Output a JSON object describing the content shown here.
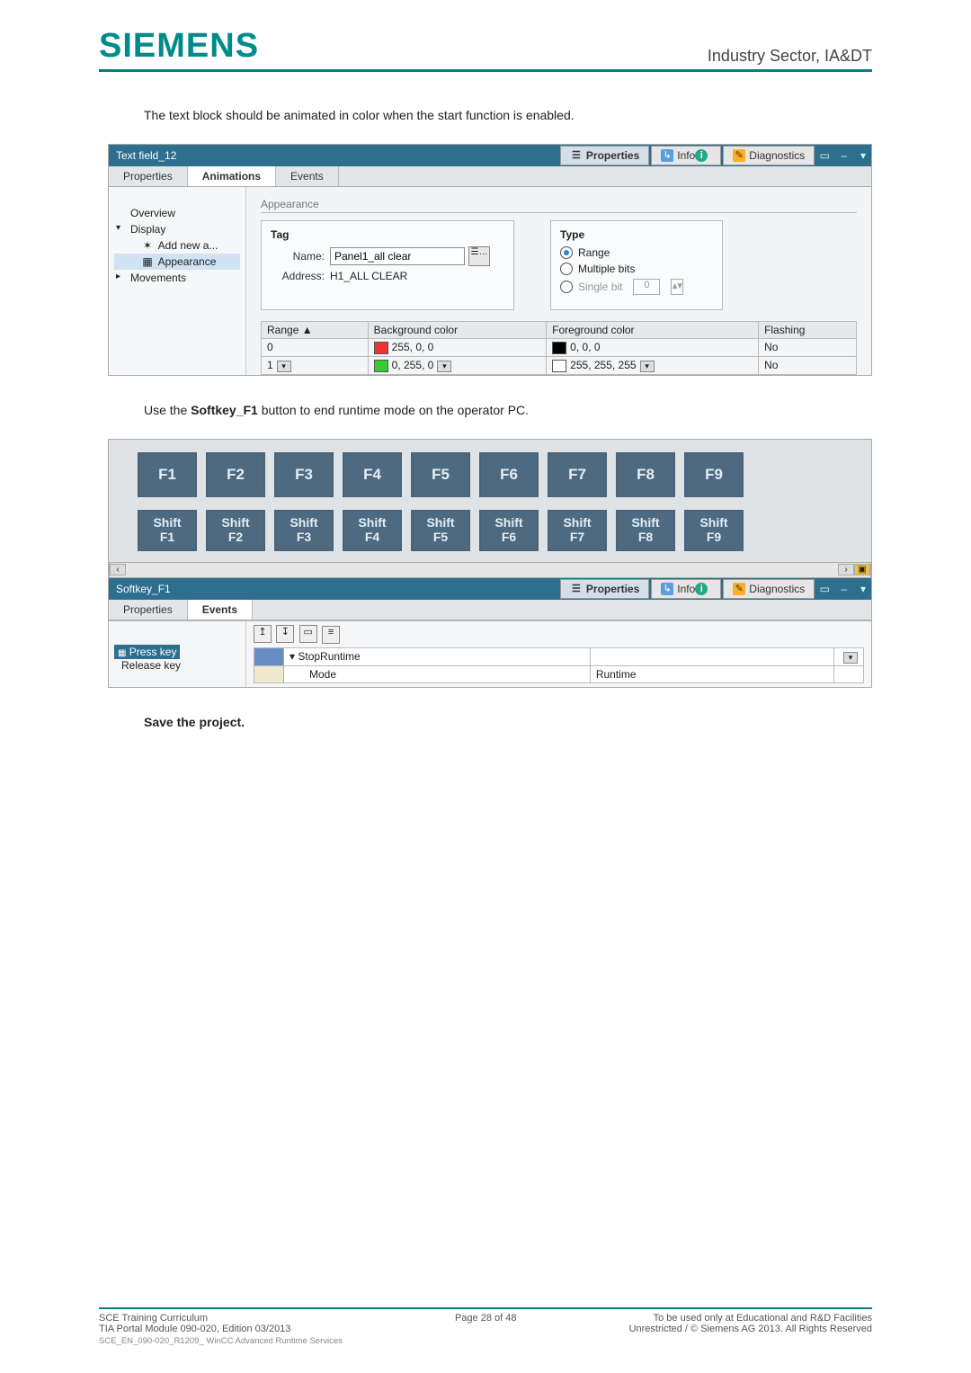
{
  "header": {
    "brand": "SIEMENS",
    "sector": "Industry Sector, IA&DT"
  },
  "intro_text": "The text block should be animated in color when the start function is enabled.",
  "panel1": {
    "title": "Text field_12",
    "tabs_top": {
      "properties": "Properties",
      "info": "Info",
      "diagnostics": "Diagnostics"
    },
    "subtabs": {
      "properties": "Properties",
      "animations": "Animations",
      "events": "Events"
    },
    "tree": {
      "overview": "Overview",
      "display": "Display",
      "add_new": "Add new a...",
      "appearance": "Appearance",
      "movements": "Movements"
    },
    "section_heading": "Appearance",
    "tag_box": {
      "title": "Tag",
      "name_label": "Name:",
      "name_value": "Panel1_all clear",
      "addr_label": "Address:",
      "addr_value": "H1_ALL CLEAR"
    },
    "type_box": {
      "title": "Type",
      "range": "Range",
      "multiple": "Multiple bits",
      "single": "Single bit",
      "single_val": "0"
    },
    "table": {
      "headers": {
        "range": "Range ▲",
        "bg": "Background color",
        "fg": "Foreground color",
        "flash": "Flashing"
      },
      "rows": [
        {
          "range": "0",
          "bg": "255, 0, 0",
          "fg": "0, 0, 0",
          "flash": "No"
        },
        {
          "range": "1",
          "bg": "0, 255, 0",
          "fg": "255, 255, 255",
          "flash": "No"
        }
      ]
    }
  },
  "mid_text_prefix": "Use the ",
  "mid_text_bold": "Softkey_F1",
  "mid_text_suffix": " button to end runtime mode on the operator PC.",
  "panel2": {
    "fkeys": [
      "F1",
      "F2",
      "F3",
      "F4",
      "F5",
      "F6",
      "F7",
      "F8",
      "F9"
    ],
    "shiftkeys": [
      "Shift\nF1",
      "Shift\nF2",
      "Shift\nF3",
      "Shift\nF4",
      "Shift\nF5",
      "Shift\nF6",
      "Shift\nF7",
      "Shift\nF8",
      "Shift\nF9"
    ],
    "title": "Softkey_F1",
    "tabs_top": {
      "properties": "Properties",
      "info": "Info",
      "diagnostics": "Diagnostics"
    },
    "subtabs": {
      "properties": "Properties",
      "events": "Events"
    },
    "events_tree": {
      "press": "Press key",
      "release": "Release key"
    },
    "events_rows": {
      "r1_name": "StopRuntime",
      "r2_name": "Mode",
      "r2_val": "Runtime"
    }
  },
  "save_text": "Save the project.",
  "footer": {
    "left1": "SCE Training Curriculum",
    "left2": "TIA Portal Module 090-020, Edition 03/2013",
    "left3": "SCE_EN_090-020_R1209_ WinCC Advanced Runtime Services",
    "center": "Page 28 of 48",
    "right1": "To be used only at Educational and R&D Facilities",
    "right2": "Unrestricted / © Siemens AG 2013. All Rights Reserved"
  }
}
